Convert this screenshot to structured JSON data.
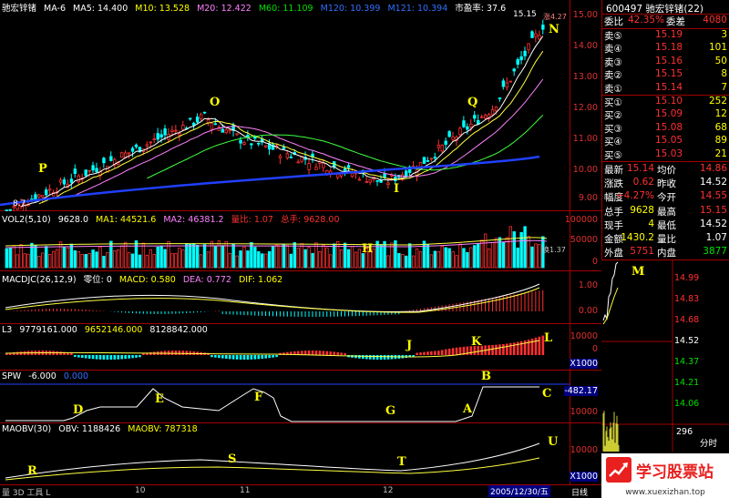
{
  "stock": {
    "name": "驰宏锌锗",
    "code": "600497",
    "title": "600497 驰宏锌锗(22)"
  },
  "main_panel": {
    "header": {
      "name": "驰宏锌锗",
      "ma_label": "MA-6",
      "ma5": "MA5: 14.400",
      "ma10": "M10: 13.528",
      "ma20": "M20: 12.422",
      "ma60": "M60: 11.109",
      "ma120": "M120: 10.399",
      "ma121": "M121: 10.394",
      "pe": "市盈率: 37.6"
    },
    "ticks": [
      "15.00",
      "14.00",
      "13.00",
      "12.00",
      "11.00",
      "10.00",
      "9.00"
    ],
    "high_label": "15.15",
    "low_label": "8.7",
    "change_label": "涨4.27",
    "markers": [
      "P",
      "O",
      "I",
      "Q",
      "N"
    ]
  },
  "vol_panel": {
    "header": {
      "name": "VOL2(5,10)",
      "value": "9628.0",
      "ma1": "MA1: 44521.6",
      "ma2": "MA2: 46381.2",
      "ratio": "量比: 1.07",
      "total": "总手: 9628.00"
    },
    "ticks": [
      "100000",
      "50000",
      "0"
    ],
    "marker": "H",
    "note": "换1.37"
  },
  "macd_panel": {
    "header": {
      "name": "MACDJC(26,12,9)",
      "zero": "零位: 0",
      "macd": "MACD: 0.580",
      "dea": "DEA: 0.772",
      "dif": "DIF: 1.062"
    },
    "ticks": [
      "1.00",
      "0.00"
    ]
  },
  "l3_panel": {
    "header": {
      "name": "L3",
      "v1": "9779161.000",
      "v2": "9652146.000",
      "v3": "8128842.000"
    },
    "ticks": [
      "10000",
      "0",
      "X1000"
    ],
    "markers": [
      "J",
      "K",
      "L"
    ]
  },
  "spw_panel": {
    "header": {
      "name": "SPW",
      "v1": "-6.000",
      "v2": "0.000"
    },
    "ticks": [
      "-482.17",
      "10000"
    ],
    "markers": [
      "D",
      "E",
      "F",
      "G",
      "A",
      "B",
      "C"
    ]
  },
  "maobv_panel": {
    "header": {
      "name": "MAOBV(30)",
      "obv": "OBV: 1188426",
      "maobv": "MAOBV: 787318"
    },
    "ticks": [
      "10000",
      "X1000"
    ],
    "markers": [
      "R",
      "S",
      "T",
      "U"
    ]
  },
  "bottom_bar": {
    "date_label": "2005/12/30/五",
    "mode_label": "日线",
    "month_10": "10",
    "month_11": "11",
    "month_12": "12",
    "nav_text": "量 3D 工具 L"
  },
  "quote": {
    "weibi_label": "委比",
    "weibi_value": "42.35%",
    "weicha_label": "委差",
    "weicha_value": "4080",
    "sells": [
      {
        "label": "卖⑤",
        "price": "15.19",
        "vol": "3"
      },
      {
        "label": "卖④",
        "price": "15.18",
        "vol": "101"
      },
      {
        "label": "卖③",
        "price": "15.16",
        "vol": "50"
      },
      {
        "label": "卖②",
        "price": "15.15",
        "vol": "8"
      },
      {
        "label": "卖①",
        "price": "15.14",
        "vol": "7"
      }
    ],
    "buys": [
      {
        "label": "买①",
        "price": "15.10",
        "vol": "252"
      },
      {
        "label": "买②",
        "price": "15.09",
        "vol": "12"
      },
      {
        "label": "买③",
        "price": "15.08",
        "vol": "68"
      },
      {
        "label": "买④",
        "price": "15.05",
        "vol": "89"
      },
      {
        "label": "买⑤",
        "price": "15.03",
        "vol": "21"
      }
    ],
    "stats": [
      {
        "l1": "最新",
        "v1": "15.14",
        "l2": "均价",
        "v2": "14.86"
      },
      {
        "l1": "涨跌",
        "v1": "0.62",
        "l2": "昨收",
        "v2": "14.52"
      },
      {
        "l1": "幅度",
        "v1": "+4.27%",
        "l2": "今开",
        "v2": "14.55"
      },
      {
        "l1": "总手",
        "v1": "9628",
        "l2": "最高",
        "v2": "15.15"
      },
      {
        "l1": "现手",
        "v1": "4",
        "l2": "最低",
        "v2": "14.52"
      },
      {
        "l1": "金额",
        "v1": "1430.2",
        "l2": "量比",
        "v2": "1.07"
      },
      {
        "l1": "外盘",
        "v1": "5751",
        "l2": "内盘",
        "v2": "3877"
      }
    ]
  },
  "intraday": {
    "ticks": [
      "14.99",
      "14.83",
      "14.68",
      "14.52",
      "14.37",
      "14.21",
      "14.06"
    ],
    "vol_tick": "296",
    "time_label": "分时",
    "marker": "M"
  },
  "watermark": {
    "brand": "学习股票站",
    "url": "www.xuexizhan.top"
  },
  "colors": {
    "up": "#ff3030",
    "down": "#00ffff",
    "grid_border": "#a00000",
    "ma_yellow": "#ffff40",
    "ma_white": "#ffffff",
    "ma_green": "#40ff40",
    "ma_blue": "#2040ff"
  }
}
